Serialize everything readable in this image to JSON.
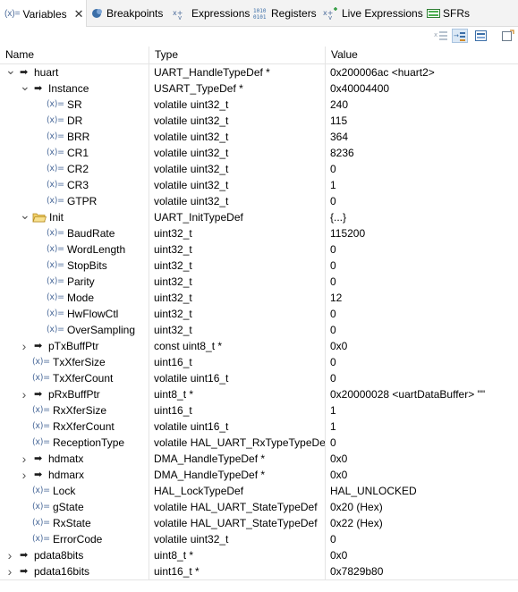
{
  "tabs": [
    {
      "label": "Variables",
      "icon": "(x)=",
      "icon_name": "variables-icon",
      "active": true
    },
    {
      "label": "Breakpoints",
      "icon_name": "breakpoints-icon"
    },
    {
      "label": "Expressions",
      "icon_name": "expressions-icon"
    },
    {
      "label": "Registers",
      "icon_name": "registers-icon",
      "icon": "1010\n0101"
    },
    {
      "label": "Live Expressions",
      "icon_name": "live-expressions-icon"
    },
    {
      "label": "SFRs",
      "icon_name": "sfrs-icon"
    }
  ],
  "columns": {
    "name": "Name",
    "type": "Type",
    "value": "Value"
  },
  "rows": [
    {
      "name": "huart",
      "type": "UART_HandleTypeDef *",
      "value": "0x200006ac <huart2>",
      "level": 0,
      "expander": "expanded",
      "icon": "pointer"
    },
    {
      "name": "Instance",
      "type": "USART_TypeDef *",
      "value": "0x40004400",
      "level": 1,
      "expander": "expanded",
      "icon": "pointer"
    },
    {
      "name": "SR",
      "type": "volatile uint32_t",
      "value": "240",
      "level": 2,
      "expander": "none",
      "icon": "var"
    },
    {
      "name": "DR",
      "type": "volatile uint32_t",
      "value": "115",
      "level": 2,
      "expander": "none",
      "icon": "var"
    },
    {
      "name": "BRR",
      "type": "volatile uint32_t",
      "value": "364",
      "level": 2,
      "expander": "none",
      "icon": "var"
    },
    {
      "name": "CR1",
      "type": "volatile uint32_t",
      "value": "8236",
      "level": 2,
      "expander": "none",
      "icon": "var"
    },
    {
      "name": "CR2",
      "type": "volatile uint32_t",
      "value": "0",
      "level": 2,
      "expander": "none",
      "icon": "var"
    },
    {
      "name": "CR3",
      "type": "volatile uint32_t",
      "value": "1",
      "level": 2,
      "expander": "none",
      "icon": "var"
    },
    {
      "name": "GTPR",
      "type": "volatile uint32_t",
      "value": "0",
      "level": 2,
      "expander": "none",
      "icon": "var"
    },
    {
      "name": "Init",
      "type": "UART_InitTypeDef",
      "value": "{...}",
      "level": 1,
      "expander": "expanded",
      "icon": "struct"
    },
    {
      "name": "BaudRate",
      "type": "uint32_t",
      "value": "115200",
      "level": 2,
      "expander": "none",
      "icon": "var"
    },
    {
      "name": "WordLength",
      "type": "uint32_t",
      "value": "0",
      "level": 2,
      "expander": "none",
      "icon": "var"
    },
    {
      "name": "StopBits",
      "type": "uint32_t",
      "value": "0",
      "level": 2,
      "expander": "none",
      "icon": "var"
    },
    {
      "name": "Parity",
      "type": "uint32_t",
      "value": "0",
      "level": 2,
      "expander": "none",
      "icon": "var"
    },
    {
      "name": "Mode",
      "type": "uint32_t",
      "value": "12",
      "level": 2,
      "expander": "none",
      "icon": "var"
    },
    {
      "name": "HwFlowCtl",
      "type": "uint32_t",
      "value": "0",
      "level": 2,
      "expander": "none",
      "icon": "var"
    },
    {
      "name": "OverSampling",
      "type": "uint32_t",
      "value": "0",
      "level": 2,
      "expander": "none",
      "icon": "var"
    },
    {
      "name": "pTxBuffPtr",
      "type": "const uint8_t *",
      "value": "0x0",
      "level": 1,
      "expander": "collapsed",
      "icon": "pointer"
    },
    {
      "name": "TxXferSize",
      "type": "uint16_t",
      "value": "0",
      "level": 1,
      "expander": "none",
      "icon": "var"
    },
    {
      "name": "TxXferCount",
      "type": "volatile uint16_t",
      "value": "0",
      "level": 1,
      "expander": "none",
      "icon": "var"
    },
    {
      "name": "pRxBuffPtr",
      "type": "uint8_t *",
      "value": "0x20000028 <uartDataBuffer> \"\"",
      "level": 1,
      "expander": "collapsed",
      "icon": "pointer"
    },
    {
      "name": "RxXferSize",
      "type": "uint16_t",
      "value": "1",
      "level": 1,
      "expander": "none",
      "icon": "var"
    },
    {
      "name": "RxXferCount",
      "type": "volatile uint16_t",
      "value": "1",
      "level": 1,
      "expander": "none",
      "icon": "var"
    },
    {
      "name": "ReceptionType",
      "type": "volatile HAL_UART_RxTypeTypeDef",
      "value": "0",
      "level": 1,
      "expander": "none",
      "icon": "var"
    },
    {
      "name": "hdmatx",
      "type": "DMA_HandleTypeDef *",
      "value": "0x0",
      "level": 1,
      "expander": "collapsed",
      "icon": "pointer"
    },
    {
      "name": "hdmarx",
      "type": "DMA_HandleTypeDef *",
      "value": "0x0",
      "level": 1,
      "expander": "collapsed",
      "icon": "pointer"
    },
    {
      "name": "Lock",
      "type": "HAL_LockTypeDef",
      "value": "HAL_UNLOCKED",
      "level": 1,
      "expander": "none",
      "icon": "var"
    },
    {
      "name": "gState",
      "type": "volatile HAL_UART_StateTypeDef",
      "value": "0x20 (Hex)",
      "level": 1,
      "expander": "none",
      "icon": "var"
    },
    {
      "name": "RxState",
      "type": "volatile HAL_UART_StateTypeDef",
      "value": "0x22 (Hex)",
      "level": 1,
      "expander": "none",
      "icon": "var"
    },
    {
      "name": "ErrorCode",
      "type": "volatile uint32_t",
      "value": "0",
      "level": 1,
      "expander": "none",
      "icon": "var"
    },
    {
      "name": "pdata8bits",
      "type": "uint8_t *",
      "value": "0x0",
      "level": 0,
      "expander": "collapsed",
      "icon": "pointer"
    },
    {
      "name": "pdata16bits",
      "type": "uint16_t *",
      "value": "0x7829b80",
      "level": 0,
      "expander": "collapsed",
      "icon": "pointer"
    }
  ],
  "var_icon_text": "(x)=",
  "colors": {
    "accent": "#3c6fa8",
    "var_icon": "#4a6a9a",
    "folder": "#e8c04a"
  }
}
